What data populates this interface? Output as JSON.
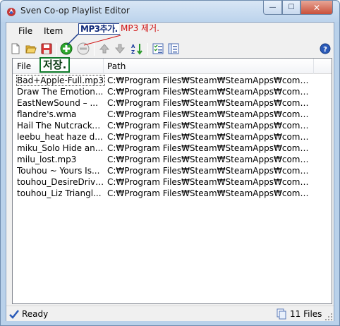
{
  "window": {
    "title": "Sven Co-op Playlist Editor",
    "close_label": "✕",
    "min_label": "—",
    "max_label": "☐"
  },
  "menu": {
    "file": "File",
    "item": "Item"
  },
  "toolbar": {
    "icons": [
      "new-icon",
      "open-icon",
      "save-icon",
      "add-icon",
      "remove-icon",
      "move-up-icon",
      "move-down-icon",
      "sort-az-icon",
      "check-list-icon",
      "list-icon",
      "help-icon"
    ]
  },
  "annotations": {
    "add": "MP3추가.",
    "remove": "MP3 제거.",
    "save": "저장."
  },
  "list": {
    "columns": [
      "File",
      "Path"
    ],
    "rows": [
      {
        "file": "Bad+Apple-Full.mp3",
        "path": "C:₩Program Files₩Steam₩SteamApps₩comm..."
      },
      {
        "file": "Draw The Emotion...",
        "path": "C:₩Program Files₩Steam₩SteamApps₩comm..."
      },
      {
        "file": "EastNewSound – ...",
        "path": "C:₩Program Files₩Steam₩SteamApps₩comm..."
      },
      {
        "file": "flandre's.wma",
        "path": "C:₩Program Files₩Steam₩SteamApps₩comm..."
      },
      {
        "file": "Hail The Nutcracke...",
        "path": "C:₩Program Files₩Steam₩SteamApps₩comm..."
      },
      {
        "file": "leebu_heat haze d...",
        "path": "C:₩Program Files₩Steam₩SteamApps₩comm..."
      },
      {
        "file": "miku_Solo Hide an...",
        "path": "C:₩Program Files₩Steam₩SteamApps₩comm..."
      },
      {
        "file": "milu_lost.mp3",
        "path": "C:₩Program Files₩Steam₩SteamApps₩comm..."
      },
      {
        "file": "Touhou ~ Yours Is...",
        "path": "C:₩Program Files₩Steam₩SteamApps₩comm..."
      },
      {
        "file": "touhou_DesireDrive...",
        "path": "C:₩Program Files₩Steam₩SteamApps₩comm..."
      },
      {
        "file": "touhou_Liz Triangl...",
        "path": "C:₩Program Files₩Steam₩SteamApps₩comm..."
      }
    ]
  },
  "status": {
    "ready": "Ready",
    "count": "11 Files"
  },
  "colors": {
    "annotation_add": "#102a7a",
    "annotation_remove": "#d01010",
    "annotation_save": "#0e7a2a"
  }
}
